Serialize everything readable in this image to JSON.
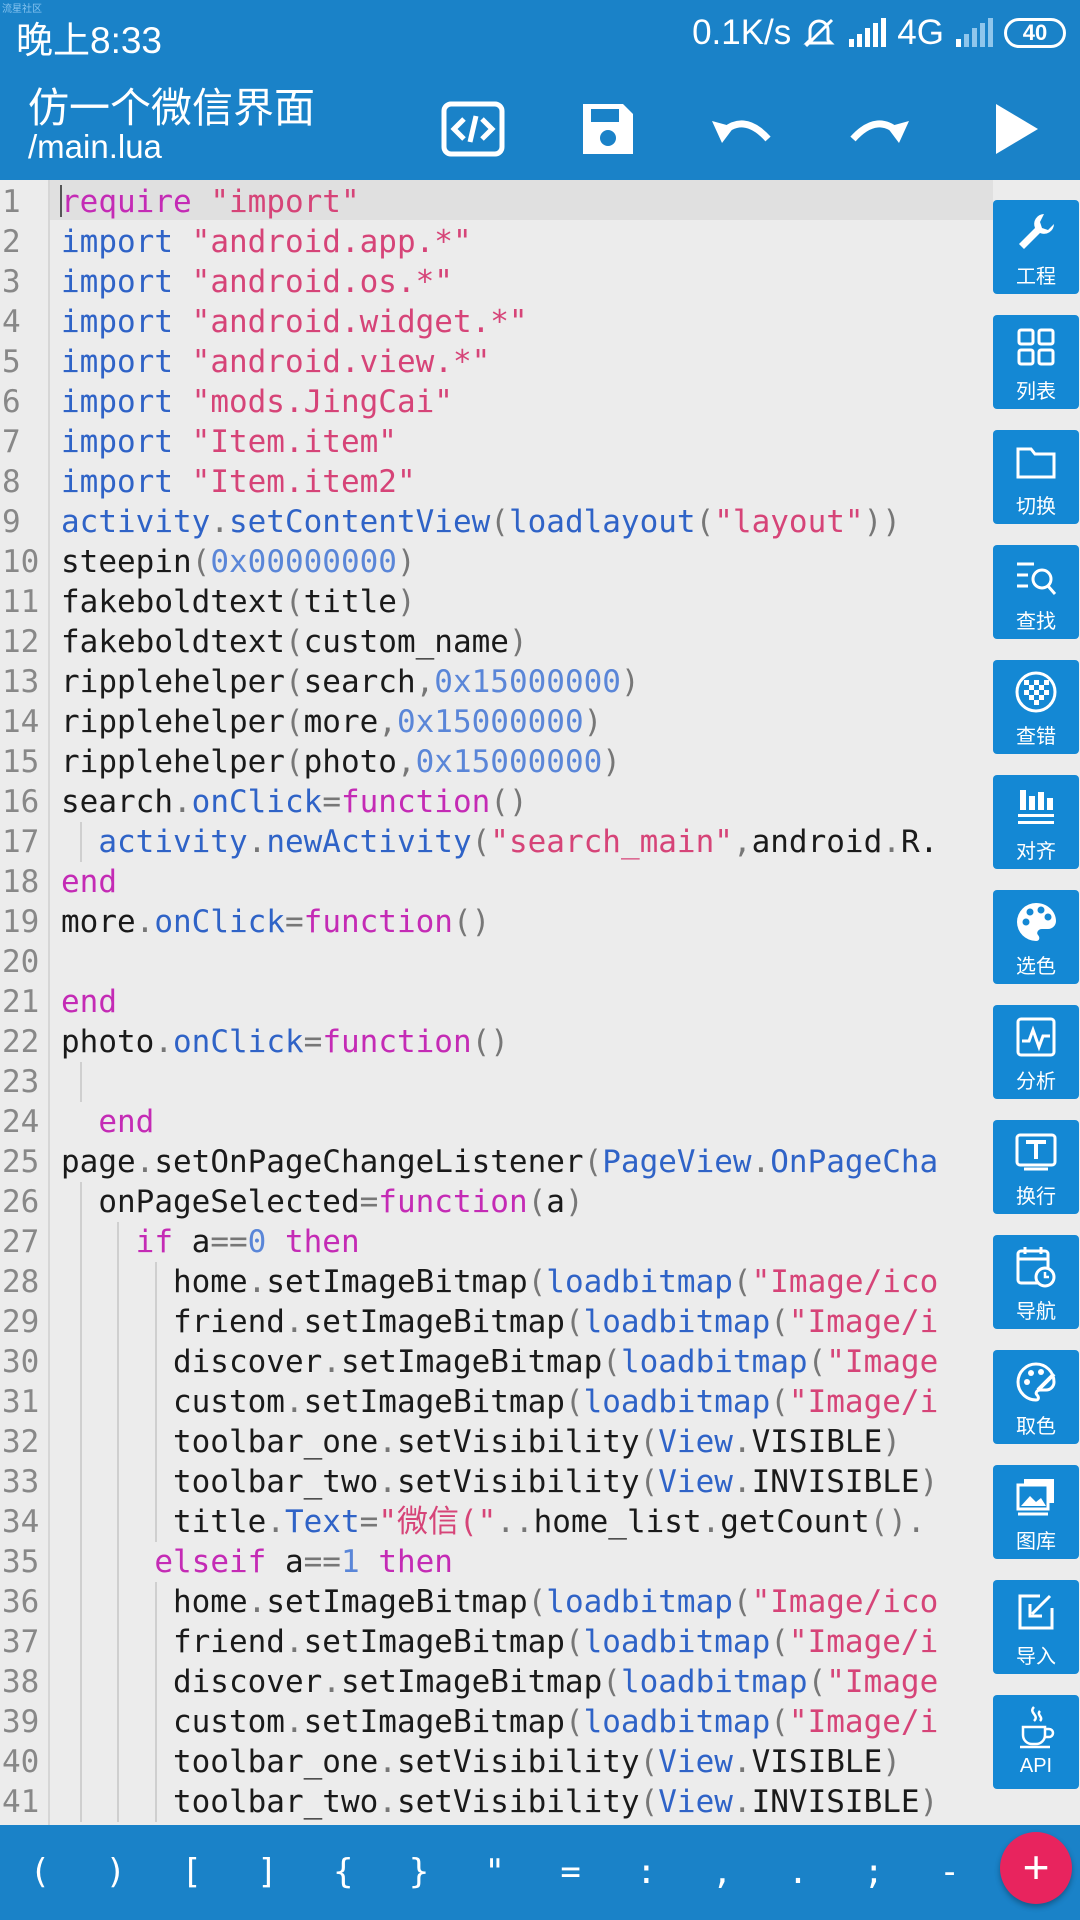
{
  "status_bar": {
    "time": "晚上8:33",
    "net_speed": "0.1K/s",
    "network": "4G",
    "battery": "40",
    "watermark": "流星社区"
  },
  "toolbar": {
    "title": "仿一个微信界面",
    "subtitle": "/main.lua",
    "actions": [
      "code-icon",
      "save-icon",
      "undo-icon",
      "redo-icon",
      "run-icon"
    ]
  },
  "editor": {
    "line_numbers": [
      "1",
      "2",
      "3",
      "4",
      "5",
      "6",
      "7",
      "8",
      "9",
      "10",
      "11",
      "12",
      "13",
      "14",
      "15",
      "16",
      "17",
      "18",
      "19",
      "20",
      "21",
      "22",
      "23",
      "24",
      "25",
      "26",
      "27",
      "28",
      "29",
      "30",
      "31",
      "32",
      "33",
      "34",
      "35",
      "36",
      "37",
      "38",
      "39",
      "40",
      "41"
    ],
    "lines": [
      [
        [
          "k",
          "require"
        ],
        [
          "i",
          " "
        ],
        [
          "s",
          "\"import\""
        ]
      ],
      [
        [
          "f",
          "import"
        ],
        [
          "i",
          " "
        ],
        [
          "s",
          "\"android.app.*\""
        ]
      ],
      [
        [
          "f",
          "import"
        ],
        [
          "i",
          " "
        ],
        [
          "s",
          "\"android.os.*\""
        ]
      ],
      [
        [
          "f",
          "import"
        ],
        [
          "i",
          " "
        ],
        [
          "s",
          "\"android.widget.*\""
        ]
      ],
      [
        [
          "f",
          "import"
        ],
        [
          "i",
          " "
        ],
        [
          "s",
          "\"android.view.*\""
        ]
      ],
      [
        [
          "f",
          "import"
        ],
        [
          "i",
          " "
        ],
        [
          "s",
          "\"mods.JingCai\""
        ]
      ],
      [
        [
          "f",
          "import"
        ],
        [
          "i",
          " "
        ],
        [
          "s",
          "\"Item.item\""
        ]
      ],
      [
        [
          "f",
          "import"
        ],
        [
          "i",
          " "
        ],
        [
          "s",
          "\"Item.item2\""
        ]
      ],
      [
        [
          "f",
          "activity"
        ],
        [
          "p",
          "."
        ],
        [
          "f",
          "setContentView"
        ],
        [
          "p",
          "("
        ],
        [
          "f",
          "loadlayout"
        ],
        [
          "p",
          "("
        ],
        [
          "s",
          "\"layout\""
        ],
        [
          "p",
          "))"
        ]
      ],
      [
        [
          "i",
          "steepin"
        ],
        [
          "p",
          "("
        ],
        [
          "n",
          "0x00000000"
        ],
        [
          "p",
          ")"
        ]
      ],
      [
        [
          "i",
          "fakeboldtext"
        ],
        [
          "p",
          "("
        ],
        [
          "i",
          "title"
        ],
        [
          "p",
          ")"
        ]
      ],
      [
        [
          "i",
          "fakeboldtext"
        ],
        [
          "p",
          "("
        ],
        [
          "i",
          "custom_name"
        ],
        [
          "p",
          ")"
        ]
      ],
      [
        [
          "i",
          "ripplehelper"
        ],
        [
          "p",
          "("
        ],
        [
          "i",
          "search"
        ],
        [
          "p",
          ","
        ],
        [
          "n",
          "0x15000000"
        ],
        [
          "p",
          ")"
        ]
      ],
      [
        [
          "i",
          "ripplehelper"
        ],
        [
          "p",
          "("
        ],
        [
          "i",
          "more"
        ],
        [
          "p",
          ","
        ],
        [
          "n",
          "0x15000000"
        ],
        [
          "p",
          ")"
        ]
      ],
      [
        [
          "i",
          "ripplehelper"
        ],
        [
          "p",
          "("
        ],
        [
          "i",
          "photo"
        ],
        [
          "p",
          ","
        ],
        [
          "n",
          "0x15000000"
        ],
        [
          "p",
          ")"
        ]
      ],
      [
        [
          "i",
          "search"
        ],
        [
          "p",
          "."
        ],
        [
          "f",
          "onClick"
        ],
        [
          "p",
          "="
        ],
        [
          "k",
          "function"
        ],
        [
          "p",
          "()"
        ]
      ],
      [
        [
          "i",
          "  "
        ],
        [
          "f",
          "activity"
        ],
        [
          "p",
          "."
        ],
        [
          "f",
          "newActivity"
        ],
        [
          "p",
          "("
        ],
        [
          "s",
          "\"search_main\""
        ],
        [
          "p",
          ","
        ],
        [
          "i",
          "android"
        ],
        [
          "p",
          "."
        ],
        [
          "i",
          "R."
        ]
      ],
      [
        [
          "k",
          "end"
        ]
      ],
      [
        [
          "i",
          "more"
        ],
        [
          "p",
          "."
        ],
        [
          "f",
          "onClick"
        ],
        [
          "p",
          "="
        ],
        [
          "k",
          "function"
        ],
        [
          "p",
          "()"
        ]
      ],
      [],
      [
        [
          "k",
          "end"
        ]
      ],
      [
        [
          "i",
          "photo"
        ],
        [
          "p",
          "."
        ],
        [
          "f",
          "onClick"
        ],
        [
          "p",
          "="
        ],
        [
          "k",
          "function"
        ],
        [
          "p",
          "()"
        ]
      ],
      [],
      [
        [
          "i",
          "  "
        ],
        [
          "k",
          "end"
        ]
      ],
      [
        [
          "i",
          "page"
        ],
        [
          "p",
          "."
        ],
        [
          "i",
          "setOnPageChangeListener"
        ],
        [
          "p",
          "("
        ],
        [
          "f",
          "PageView"
        ],
        [
          "p",
          "."
        ],
        [
          "f",
          "OnPageCha"
        ]
      ],
      [
        [
          "i",
          "  onPageSelected"
        ],
        [
          "p",
          "="
        ],
        [
          "k",
          "function"
        ],
        [
          "p",
          "("
        ],
        [
          "i",
          "a"
        ],
        [
          "p",
          ")"
        ]
      ],
      [
        [
          "i",
          "    "
        ],
        [
          "k",
          "if"
        ],
        [
          "i",
          " a"
        ],
        [
          "p",
          "=="
        ],
        [
          "n",
          "0"
        ],
        [
          "i",
          " "
        ],
        [
          "k",
          "then"
        ]
      ],
      [
        [
          "i",
          "      home"
        ],
        [
          "p",
          "."
        ],
        [
          "i",
          "setImageBitmap"
        ],
        [
          "p",
          "("
        ],
        [
          "f",
          "loadbitmap"
        ],
        [
          "p",
          "("
        ],
        [
          "s",
          "\"Image/ico"
        ]
      ],
      [
        [
          "i",
          "      friend"
        ],
        [
          "p",
          "."
        ],
        [
          "i",
          "setImageBitmap"
        ],
        [
          "p",
          "("
        ],
        [
          "f",
          "loadbitmap"
        ],
        [
          "p",
          "("
        ],
        [
          "s",
          "\"Image/i"
        ]
      ],
      [
        [
          "i",
          "      discover"
        ],
        [
          "p",
          "."
        ],
        [
          "i",
          "setImageBitmap"
        ],
        [
          "p",
          "("
        ],
        [
          "f",
          "loadbitmap"
        ],
        [
          "p",
          "("
        ],
        [
          "s",
          "\"Image"
        ]
      ],
      [
        [
          "i",
          "      custom"
        ],
        [
          "p",
          "."
        ],
        [
          "i",
          "setImageBitmap"
        ],
        [
          "p",
          "("
        ],
        [
          "f",
          "loadbitmap"
        ],
        [
          "p",
          "("
        ],
        [
          "s",
          "\"Image/i"
        ]
      ],
      [
        [
          "i",
          "      toolbar_one"
        ],
        [
          "p",
          "."
        ],
        [
          "i",
          "setVisibility"
        ],
        [
          "p",
          "("
        ],
        [
          "f",
          "View"
        ],
        [
          "p",
          "."
        ],
        [
          "i",
          "VISIBLE"
        ],
        [
          "p",
          ")"
        ]
      ],
      [
        [
          "i",
          "      toolbar_two"
        ],
        [
          "p",
          "."
        ],
        [
          "i",
          "setVisibility"
        ],
        [
          "p",
          "("
        ],
        [
          "f",
          "View"
        ],
        [
          "p",
          "."
        ],
        [
          "i",
          "INVISIBLE"
        ],
        [
          "p",
          ")"
        ]
      ],
      [
        [
          "i",
          "      title"
        ],
        [
          "p",
          "."
        ],
        [
          "f",
          "Text"
        ],
        [
          "p",
          "="
        ],
        [
          "s",
          "\"微信(\""
        ],
        [
          "p",
          ".."
        ],
        [
          "i",
          "home_list"
        ],
        [
          "p",
          "."
        ],
        [
          "i",
          "getCount"
        ],
        [
          "p",
          "()."
        ]
      ],
      [
        [
          "i",
          "     "
        ],
        [
          "k",
          "elseif"
        ],
        [
          "i",
          " a"
        ],
        [
          "p",
          "=="
        ],
        [
          "n",
          "1"
        ],
        [
          "i",
          " "
        ],
        [
          "k",
          "then"
        ]
      ],
      [
        [
          "i",
          "      home"
        ],
        [
          "p",
          "."
        ],
        [
          "i",
          "setImageBitmap"
        ],
        [
          "p",
          "("
        ],
        [
          "f",
          "loadbitmap"
        ],
        [
          "p",
          "("
        ],
        [
          "s",
          "\"Image/ico"
        ]
      ],
      [
        [
          "i",
          "      friend"
        ],
        [
          "p",
          "."
        ],
        [
          "i",
          "setImageBitmap"
        ],
        [
          "p",
          "("
        ],
        [
          "f",
          "loadbitmap"
        ],
        [
          "p",
          "("
        ],
        [
          "s",
          "\"Image/i"
        ]
      ],
      [
        [
          "i",
          "      discover"
        ],
        [
          "p",
          "."
        ],
        [
          "i",
          "setImageBitmap"
        ],
        [
          "p",
          "("
        ],
        [
          "f",
          "loadbitmap"
        ],
        [
          "p",
          "("
        ],
        [
          "s",
          "\"Image"
        ]
      ],
      [
        [
          "i",
          "      custom"
        ],
        [
          "p",
          "."
        ],
        [
          "i",
          "setImageBitmap"
        ],
        [
          "p",
          "("
        ],
        [
          "f",
          "loadbitmap"
        ],
        [
          "p",
          "("
        ],
        [
          "s",
          "\"Image/i"
        ]
      ],
      [
        [
          "i",
          "      toolbar_one"
        ],
        [
          "p",
          "."
        ],
        [
          "i",
          "setVisibility"
        ],
        [
          "p",
          "("
        ],
        [
          "f",
          "View"
        ],
        [
          "p",
          "."
        ],
        [
          "i",
          "VISIBLE"
        ],
        [
          "p",
          ")"
        ]
      ],
      [
        [
          "i",
          "      toolbar_two"
        ],
        [
          "p",
          "."
        ],
        [
          "i",
          "setVisibility"
        ],
        [
          "p",
          "("
        ],
        [
          "f",
          "View"
        ],
        [
          "p",
          "."
        ],
        [
          "i",
          "INVISIBLE"
        ],
        [
          "p",
          ")"
        ]
      ]
    ]
  },
  "side_panel": [
    {
      "label": "工程",
      "icon": "wrench-icon"
    },
    {
      "label": "列表",
      "icon": "grid-icon"
    },
    {
      "label": "切换",
      "icon": "folder-icon"
    },
    {
      "label": "查找",
      "icon": "search-list-icon"
    },
    {
      "label": "查错",
      "icon": "mosaic-icon"
    },
    {
      "label": "对齐",
      "icon": "align-icon"
    },
    {
      "label": "选色",
      "icon": "palette-icon"
    },
    {
      "label": "分析",
      "icon": "analysis-icon"
    },
    {
      "label": "换行",
      "icon": "wrap-icon"
    },
    {
      "label": "导航",
      "icon": "calendar-clock-icon"
    },
    {
      "label": "取色",
      "icon": "color-picker-icon"
    },
    {
      "label": "图库",
      "icon": "gallery-icon"
    },
    {
      "label": "导入",
      "icon": "import-icon"
    },
    {
      "label": "API",
      "icon": "java-cup-icon"
    }
  ],
  "symbols": [
    "(",
    ")",
    "[",
    "]",
    "{",
    "}",
    "\"",
    "=",
    ":",
    ",",
    ".",
    ";",
    "-"
  ],
  "fab_label": "+"
}
